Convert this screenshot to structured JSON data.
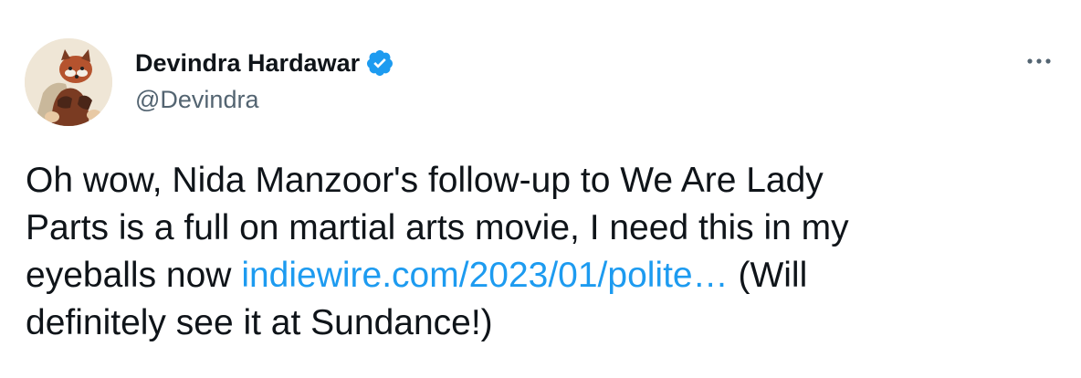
{
  "author": {
    "display_name": "Devindra Hardawar",
    "handle": "@Devindra",
    "verified": true,
    "verified_color": "#1d9bf0",
    "avatar_icon": "red-panda-avatar"
  },
  "menu": {
    "icon": "more-horizontal-icon"
  },
  "tweet": {
    "line1": "Oh wow, Nida Manzoor's follow-up to We Are Lady",
    "line2": "Parts is a full on martial arts movie, I need this in my",
    "line3_prefix": "eyeballs now ",
    "link_text": "indiewire.com/2023/01/polite…",
    "line3_suffix": " (Will",
    "line4": "definitely see it at Sundance!)",
    "link_color": "#1d9bf0"
  }
}
